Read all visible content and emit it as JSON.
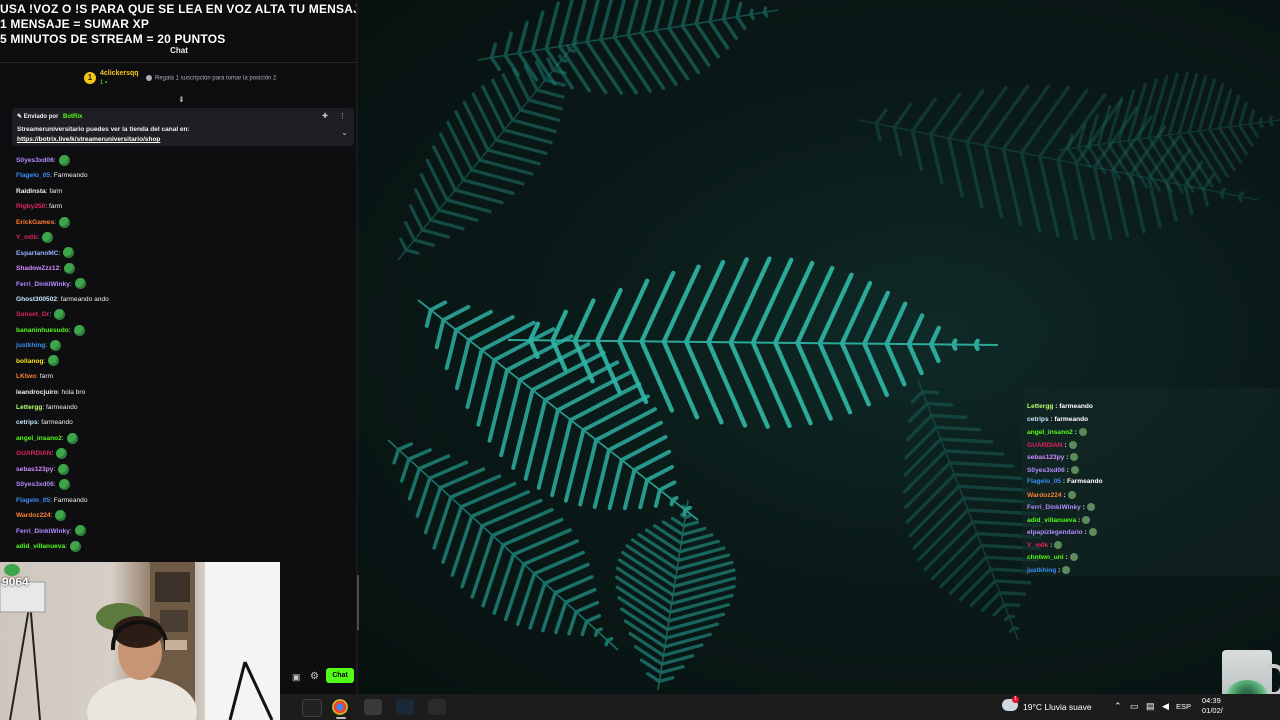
{
  "stream_overlay": {
    "lines": [
      "USA !VOZ O !S PARA QUE SE LEA EN VOZ ALTA TU MENSAJE",
      "1 MENSAJE = SUMAR XP",
      "5 MINUTOS DE STREAM = 20 PUNTOS"
    ]
  },
  "chat": {
    "header": "Chat",
    "leaderboard": {
      "rank": "1",
      "name": "4clickersqq",
      "sub_count": "1",
      "hint": "Regala 1 suscripción para tomar la posición 2"
    },
    "pinned": {
      "sent_by_label": "Enviado por",
      "bot_name": "BotRix",
      "text": "Streameruniversitario puedes ver la tienda del canal en:",
      "link": "https://botrix.live/k/streameruniversitario/shop"
    },
    "messages": [
      {
        "user": "S0yes3xd06",
        "color": "#b18cff",
        "text": "",
        "emote": true
      },
      {
        "user": "Flagelo_05",
        "color": "#3a8ff5",
        "text": " Farmeando",
        "emote": false
      },
      {
        "user": "RaidInsta",
        "color": "#efeff1",
        "text": " farm",
        "emote": false
      },
      {
        "user": "Rigby250",
        "color": "#e0245e",
        "text": " farm",
        "emote": false
      },
      {
        "user": "ErickGames",
        "color": "#ff7f32",
        "text": "",
        "emote": true
      },
      {
        "user": "Y_m0k",
        "color": "#e0245e",
        "text": "",
        "emote": true
      },
      {
        "user": "EspartanoMC",
        "color": "#8fb2ff",
        "text": "",
        "emote": true
      },
      {
        "user": "ShadowZzz12",
        "color": "#d18cff",
        "text": "",
        "emote": true
      },
      {
        "user": "Ferri_DinkiWinky",
        "color": "#b18cff",
        "text": "",
        "emote": true
      },
      {
        "user": "Ghost300502",
        "color": "#c9e7ff",
        "text": " farmeando ando",
        "emote": false
      },
      {
        "user": "Sunset_Gr",
        "color": "#e0245e",
        "text": "",
        "emote": true
      },
      {
        "user": "bananinhuesudo",
        "color": "#53fc18",
        "text": "",
        "emote": true
      },
      {
        "user": "justkhing",
        "color": "#3a8ff5",
        "text": "",
        "emote": true
      },
      {
        "user": "bollanog",
        "color": "#f5e218",
        "text": "",
        "emote": true
      },
      {
        "user": "LKtwo",
        "color": "#ff7f32",
        "text": " farm",
        "emote": false
      },
      {
        "user": "leandrocjuiro",
        "color": "#efeff1",
        "text": " hola bro",
        "emote": false
      },
      {
        "user": "Lettergg",
        "color": "#b6ff6b",
        "text": " farmeando",
        "emote": false
      },
      {
        "user": "cetrips",
        "color": "#c9e7ff",
        "text": " farmeando",
        "emote": false
      },
      {
        "user": "angel_insano2",
        "color": "#53fc18",
        "text": "",
        "emote": true
      },
      {
        "user": "GUARDIAN",
        "color": "#e0245e",
        "text": "",
        "emote": true
      },
      {
        "user": "sebas123py",
        "color": "#d18cff",
        "text": "",
        "emote": true
      },
      {
        "user": "S0yes3xd06",
        "color": "#b18cff",
        "text": "",
        "emote": true
      },
      {
        "user": "Flagelo_05",
        "color": "#3a8ff5",
        "text": " Farmeando",
        "emote": false
      },
      {
        "user": "Wardoz224",
        "color": "#ff7f32",
        "text": "",
        "emote": true
      },
      {
        "user": "Ferri_DinkiWinky",
        "color": "#b18cff",
        "text": "",
        "emote": true
      },
      {
        "user": "adid_villanueva",
        "color": "#53fc18",
        "text": "",
        "emote": true
      }
    ],
    "send_button": "Chat"
  },
  "webcam": {
    "counter": "9064"
  },
  "overlay_chat": {
    "messages": [
      {
        "user": "Lettergg",
        "color": "#b6ff6b",
        "text": " : farmeando",
        "emote": false
      },
      {
        "user": "cetrips",
        "color": "#c9e7ff",
        "text": " : farmeando",
        "emote": false
      },
      {
        "user": "angel_insano2",
        "color": "#53fc18",
        "text": " :",
        "emote": true
      },
      {
        "user": "GUARDIAN",
        "color": "#e0245e",
        "text": " :",
        "emote": true
      },
      {
        "user": "sebas123py",
        "color": "#d18cff",
        "text": " :",
        "emote": true
      },
      {
        "user": "S0yes3xd06",
        "color": "#b18cff",
        "text": " :",
        "emote": true
      },
      {
        "user": "Flagelo_05",
        "color": "#3a8ff5",
        "text": " : Farmeando",
        "emote": false
      },
      {
        "user": "Wardoz224",
        "color": "#ff7f32",
        "text": " :",
        "emote": true
      },
      {
        "user": "Ferri_DinkiWinky",
        "color": "#b18cff",
        "text": " :",
        "emote": true
      },
      {
        "user": "adid_villanueva",
        "color": "#53fc18",
        "text": " :",
        "emote": true
      },
      {
        "user": "elpapizlegendario",
        "color": "#b18cff",
        "text": " :",
        "emote": true
      },
      {
        "user": "Y_m0k",
        "color": "#e0245e",
        "text": " :",
        "emote": true
      },
      {
        "user": "chntwn_uni",
        "color": "#53fc18",
        "text": " :",
        "emote": true
      },
      {
        "user": "justkhing",
        "color": "#3a8ff5",
        "text": " :",
        "emote": true
      }
    ]
  },
  "taskbar": {
    "weather_badge": "1",
    "weather": "19°C  Lluvia suave",
    "language": "ESP",
    "time": "04:39",
    "date": "01/02/"
  },
  "colors": {
    "kick_green": "#53fc18",
    "panel_bg": "#0e0e10",
    "taskbar_bg": "#1c1c1c",
    "fern_teal": "#2fb8a8"
  }
}
